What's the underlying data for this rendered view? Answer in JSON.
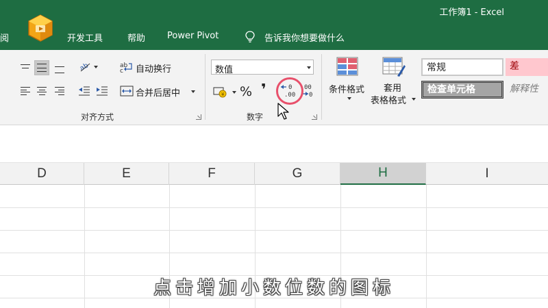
{
  "window": {
    "title": "工作簿1  -  Excel"
  },
  "menu": {
    "items": [
      {
        "id": "view-partial",
        "label": "阅"
      },
      {
        "id": "developer",
        "label": "开发工具"
      },
      {
        "id": "help",
        "label": "帮助"
      },
      {
        "id": "powerpivot",
        "label": "Power Pivot"
      }
    ],
    "tell_me": "告诉我你想要做什么"
  },
  "ribbon": {
    "alignment": {
      "wrap_text": "自动换行",
      "merge_center": "合并后居中",
      "group_label": "对齐方式"
    },
    "number": {
      "format_value": "数值",
      "percent_symbol": "%",
      "comma_symbol": "❜",
      "group_label": "数字"
    },
    "styles": {
      "conditional_format": [
        "条件格式"
      ],
      "format_as_table": [
        "套用",
        "表格格式"
      ],
      "cell_normal": "常规",
      "cell_bad": "差",
      "cell_check": "检查单元格",
      "cell_explanatory": "解释性"
    }
  },
  "grid": {
    "columns": [
      "D",
      "E",
      "F",
      "G",
      "H",
      "I"
    ],
    "selected_column": "H"
  },
  "subtitle": "点击增加小数位数的图标",
  "colors": {
    "brand_green": "#1e6d42",
    "highlight": "#e8506b",
    "bad_fill": "#ffc7ce"
  }
}
